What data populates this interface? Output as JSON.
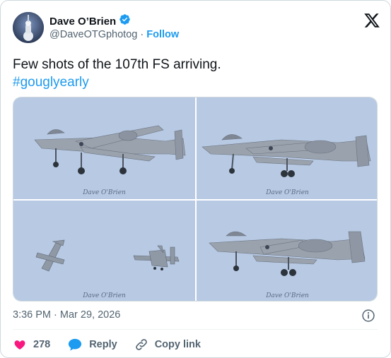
{
  "author": {
    "display_name": "Dave O’Brien",
    "handle": "@DaveOTGphotog",
    "separator": "·",
    "follow_label": "Follow"
  },
  "tweet": {
    "text": "Few shots of the 107th FS arriving.",
    "hashtag": "#gouglyearly"
  },
  "media": {
    "signature": "Dave O'Brien",
    "photos": [
      {
        "subject": "A-10 aircraft landing, gear down"
      },
      {
        "subject": "A-10 aircraft landing, gear down"
      },
      {
        "subject": "Two A-10 aircraft in flight"
      },
      {
        "subject": "A-10 aircraft landing, gear down"
      }
    ]
  },
  "meta": {
    "timestamp": "3:36 PM · Mar 29, 2026"
  },
  "actions": {
    "like_count": "278",
    "reply_label": "Reply",
    "copy_link_label": "Copy link"
  },
  "colors": {
    "accent": "#1d9bf0",
    "like": "#f91880",
    "secondary_text": "#536471",
    "verified": "#1d9bf0"
  }
}
